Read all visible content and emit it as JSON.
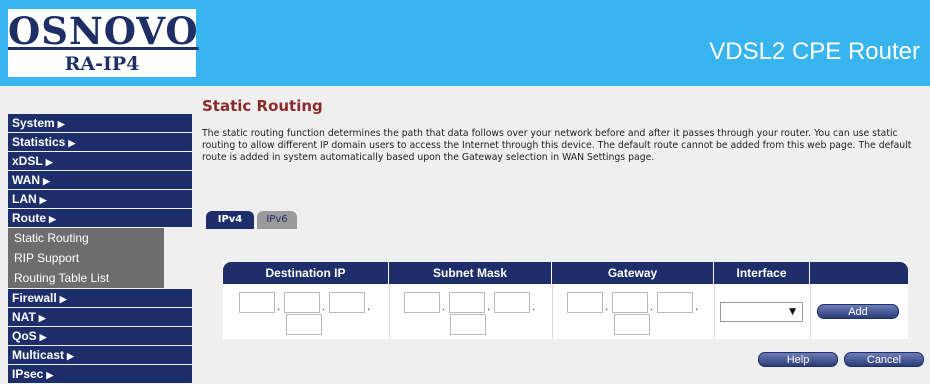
{
  "header": {
    "logo": "OSNOVO",
    "model": "RA-IP4",
    "title": "VDSL2 CPE Router"
  },
  "sidebar": {
    "items": [
      {
        "label": "System",
        "arrow": "▶"
      },
      {
        "label": "Statistics",
        "arrow": "▶"
      },
      {
        "label": "xDSL",
        "arrow": "▶"
      },
      {
        "label": "WAN",
        "arrow": "▶"
      },
      {
        "label": "LAN",
        "arrow": "▶"
      },
      {
        "label": "Route",
        "arrow": "▶"
      }
    ],
    "route_sub": [
      {
        "label": "Static Routing"
      },
      {
        "label": "RIP Support"
      },
      {
        "label": "Routing Table List"
      }
    ],
    "items_after": [
      {
        "label": "Firewall",
        "arrow": "▶"
      },
      {
        "label": "NAT",
        "arrow": "▶"
      },
      {
        "label": "QoS",
        "arrow": "▶"
      },
      {
        "label": "Multicast",
        "arrow": "▶"
      },
      {
        "label": "IPsec",
        "arrow": "▶"
      }
    ]
  },
  "main": {
    "page_title": "Static Routing",
    "description": "The static routing function determines the path that data follows over your network before and after it passes through your router. You can use static routing to allow different IP domain users to access the Internet through this device. The default route cannot be added from this web page. The default route is added in system automatically based upon the Gateway selection in WAN Settings page.",
    "tabs": [
      {
        "label": "IPv4",
        "active": true
      },
      {
        "label": "IPv6",
        "active": false
      }
    ],
    "table": {
      "headers": [
        "Destination IP",
        "Subnet Mask",
        "Gateway",
        "Interface",
        ""
      ],
      "interface_value": "",
      "add_label": "Add"
    },
    "help_label": "Help",
    "cancel_label": "Cancel"
  },
  "colors": {
    "header_bg": "#38b4ee",
    "nav_bg": "#1d2e6a",
    "submenu_bg": "#6d6d6d",
    "title_color": "#8b2b2b"
  },
  "icons": {
    "nav_arrow": "triangle-right-icon",
    "select_chevron": "triangle-down-icon"
  }
}
